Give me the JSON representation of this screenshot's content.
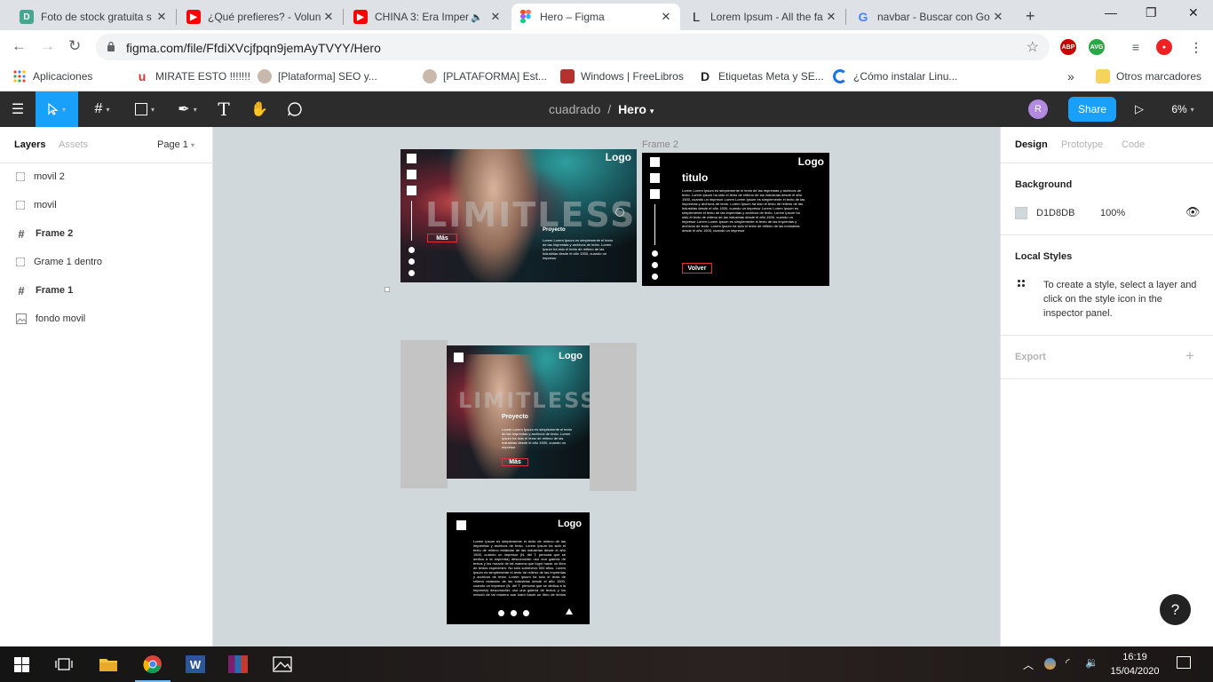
{
  "browser": {
    "tabs": [
      {
        "title": "Foto de stock gratuita s",
        "icon": "dreamstime-icon",
        "active": false
      },
      {
        "title": "¿Qué prefieres? - Volun",
        "icon": "youtube-icon",
        "active": false
      },
      {
        "title": "CHINA 3: Era Imper",
        "icon": "youtube-icon",
        "active": false
      },
      {
        "title": "Hero – Figma",
        "icon": "figma-icon",
        "active": true
      },
      {
        "title": "Lorem Ipsum - All the fa",
        "icon": "lipsum-icon",
        "active": false
      },
      {
        "title": "navbar - Buscar con Go",
        "icon": "google-icon",
        "active": false
      }
    ],
    "url": "figma.com/file/FfdiXVcjfpqn9jemAyTVYY/Hero",
    "bookmarks": [
      {
        "label": "Aplicaciones",
        "icon": "apps-grid-icon"
      },
      {
        "label": "MIRATE ESTO !!!!!!!",
        "icon": "u-logo-icon"
      },
      {
        "label": "[Plataforma] SEO y...",
        "icon": "avatar-icon"
      },
      {
        "label": "[PLATAFORMA] Est...",
        "icon": "avatar-icon"
      },
      {
        "label": "Windows | FreeLibros",
        "icon": "book-icon"
      },
      {
        "label": "Etiquetas Meta y SE...",
        "icon": "d-logo-icon"
      },
      {
        "label": "¿Cómo instalar Linu...",
        "icon": "blue-c-icon"
      }
    ],
    "other_bookmarks": "Otros marcadores",
    "more_bookmarks": "»"
  },
  "figma": {
    "project": "cuadrado",
    "separator": "/",
    "file": "Hero",
    "avatar_letter": "R",
    "share_label": "Share",
    "zoom": "6%",
    "left_tabs": {
      "layers": "Layers",
      "assets": "Assets",
      "page": "Page 1"
    },
    "layers": [
      {
        "name": "movil 2",
        "type": "group"
      },
      {
        "name": "movil",
        "type": "group"
      },
      {
        "name": "Frame 2",
        "type": "frame"
      },
      {
        "name": "Grame 1 dentro",
        "type": "group"
      },
      {
        "name": "Frame 1",
        "type": "frame"
      },
      {
        "name": "fondo movil",
        "type": "image"
      }
    ],
    "right_tabs": {
      "design": "Design",
      "prototype": "Prototype",
      "code": "Code"
    },
    "background": {
      "title": "Background",
      "hex": "D1D8DB",
      "opacity": "100%",
      "color": "#D1D8DB"
    },
    "local_styles": {
      "title": "Local Styles",
      "hint": "To create a style, select a layer and click on the style icon in the inspector panel."
    },
    "export": {
      "title": "Export",
      "add": "+"
    },
    "help": "?"
  },
  "canvas": {
    "frame2_label": "Frame 2",
    "hero": {
      "logo": "Logo",
      "headline": "LIMITLESS",
      "project": "Proyecto",
      "more": "Más",
      "body": "Lorem Lorem Ipsum es simplemente el texto de las imprentas y archivos de texto. Lorem Ipsum ha sido el texto de relleno de las industrias desde el año 1500, cuando un impresor"
    },
    "frame2": {
      "logo": "Logo",
      "title": "titulo",
      "back": "Volver",
      "body": "Lorem Lorem Ipsum es simplemente el texto de las imprentas y archivos de texto. Lorem Ipsum ha sido el texto de relleno de las industrias desde el año 1500, cuando un impresor Lorem Lorem Ipsum es simplemente el texto de las imprentas y archivos de texto. Lorem Ipsum ha sido el texto de relleno de las industrias desde el año 1500, cuando un impresor Lorem Lorem Ipsum es simplemente el texto de las imprentas y archivos de texto. Lorem Ipsum ha sido el texto de relleno de las industrias desde el año 1500, cuando un impresor Lorem Lorem Ipsum es simplemente el texto de las imprentas y archivos de texto. Lorem Ipsum ha sido el texto de relleno de las industrias desde el año 1500, cuando un impresor"
    },
    "mobile": {
      "logo": "Logo",
      "headline": "LIMITLESS",
      "project": "Proyecto",
      "more": "Más",
      "body": "Lorem Lorem Ipsum es simplemente el texto de las imprentas y archivos de texto. Lorem Ipsum ha sido el texto de relleno de las industrias desde el año 1500, cuando un impresor"
    },
    "mobile2": {
      "logo": "Logo",
      "body": "Lorem Ipsum es simplemente el texto de relleno de las imprentas y archivos de texto. Lorem Ipsum ha sido el texto de relleno estándar de las industrias desde el año 1500, cuando un impresor (N. del T. persona que se dedica a la imprenta) desconocido usó una galería de textos y los mezcló de tal manera que logró hacer un libro de textos especimen. No sólo sobrevivió 500 años. Lorem Ipsum es simplemente el texto de relleno de las imprentas y archivos de texto. Lorem Ipsum ha sido el texto de relleno estándar de las industrias desde el año 1500, cuando un impresor (N. del T. persona que se dedica a la imprenta) desconocido usó una galería de textos y los mezcló de tal manera que logró hacer un libro de textos especimen. No sólo sobrevivió 500 años."
    }
  },
  "taskbar": {
    "time": "16:19",
    "date": "15/04/2020"
  }
}
